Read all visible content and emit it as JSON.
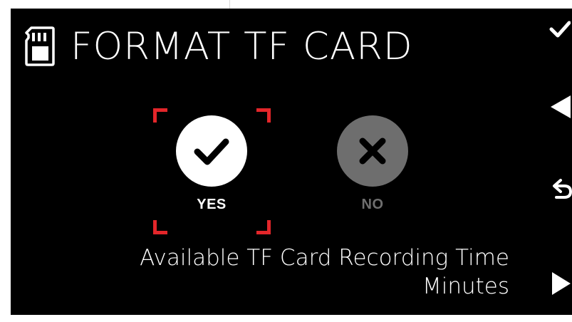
{
  "screen": {
    "title": "FORMAT TF CARD",
    "title_icon": "sd-card-icon"
  },
  "options": {
    "yes": {
      "label": "YES",
      "icon": "check-icon",
      "selected": true
    },
    "no": {
      "label": "NO",
      "icon": "x-icon",
      "selected": false
    }
  },
  "info": {
    "line1": "Available TF Card Recording Time",
    "line2": "Minutes"
  },
  "side_buttons": [
    "check-icon",
    "triangle-left-icon",
    "back-arrow-icon",
    "triangle-right-icon"
  ],
  "colors": {
    "background": "#000000",
    "text": "#ffffff",
    "selection_bracket": "#e3262a",
    "disabled": "#6e6e6e"
  }
}
